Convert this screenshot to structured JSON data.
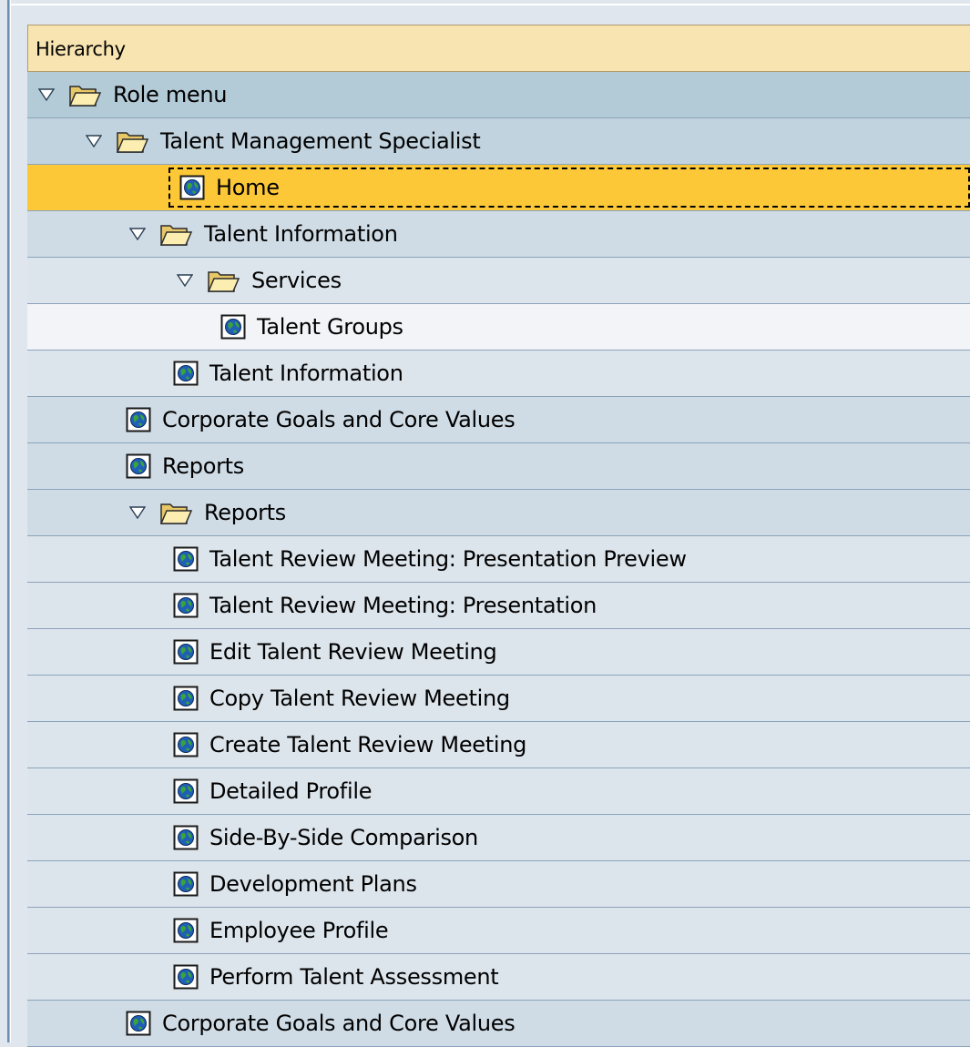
{
  "hierarchy": {
    "header": "Hierarchy",
    "rows": [
      {
        "label": "Role menu",
        "level": 1,
        "type": "folder",
        "expanded": true
      },
      {
        "label": "Talent Management Specialist",
        "level": 2,
        "type": "folder",
        "expanded": true
      },
      {
        "label": "Home",
        "level": 3,
        "type": "transaction",
        "selected": true
      },
      {
        "label": "Talent Information",
        "level": 3,
        "type": "folder",
        "expanded": true
      },
      {
        "label": "Services",
        "level": 4,
        "type": "folder",
        "expanded": true
      },
      {
        "label": "Talent Groups",
        "level": 5,
        "type": "transaction"
      },
      {
        "label": "Talent Information",
        "level": 4,
        "type": "transaction"
      },
      {
        "label": "Corporate Goals and Core Values",
        "level": 3,
        "type": "transaction"
      },
      {
        "label": "Reports",
        "level": 3,
        "type": "transaction"
      },
      {
        "label": "Reports",
        "level": 3,
        "type": "folder",
        "expanded": true
      },
      {
        "label": "Talent Review Meeting: Presentation Preview",
        "level": 4,
        "type": "transaction"
      },
      {
        "label": "Talent Review Meeting: Presentation",
        "level": 4,
        "type": "transaction"
      },
      {
        "label": "Edit Talent Review Meeting",
        "level": 4,
        "type": "transaction"
      },
      {
        "label": "Copy Talent Review Meeting",
        "level": 4,
        "type": "transaction"
      },
      {
        "label": "Create Talent Review Meeting",
        "level": 4,
        "type": "transaction"
      },
      {
        "label": "Detailed Profile",
        "level": 4,
        "type": "transaction"
      },
      {
        "label": "Side-By-Side Comparison",
        "level": 4,
        "type": "transaction"
      },
      {
        "label": "Development Plans",
        "level": 4,
        "type": "transaction"
      },
      {
        "label": "Employee Profile",
        "level": 4,
        "type": "transaction"
      },
      {
        "label": "Perform Talent Assessment",
        "level": 4,
        "type": "transaction"
      },
      {
        "label": "Corporate Goals and Core Values",
        "level": 3,
        "type": "transaction"
      }
    ]
  },
  "icons": {
    "expander": "triangle-down-icon",
    "folder": "folder-open-icon",
    "transaction": "transaction-globe-icon"
  },
  "colors": {
    "header_bg": "#f7e4b0",
    "selected_bg": "#fcc838",
    "level_1_bg": "#b3cad7",
    "level_2_bg": "#c1d3de",
    "level_3_bg": "#cfdce6",
    "level_4_bg": "#dde5ec",
    "level_5_bg": "#f2f4f7"
  }
}
